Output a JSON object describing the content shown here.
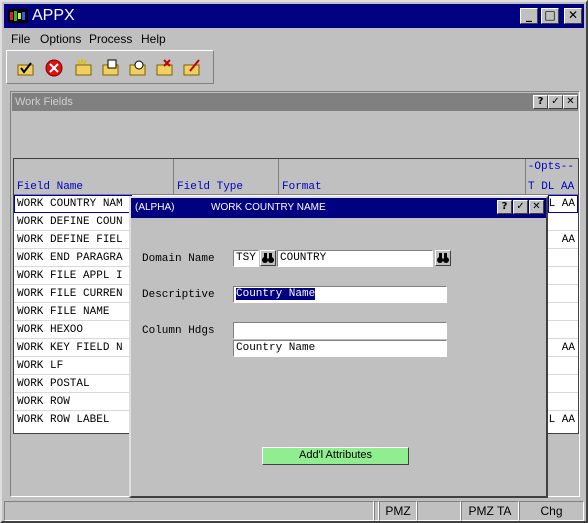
{
  "app": {
    "title": "APPX"
  },
  "window_controls": {
    "minimize": "_",
    "maximize": "□",
    "close": "✕"
  },
  "menu": [
    "File",
    "Options",
    "Process",
    "Help"
  ],
  "toolbar": {
    "icons": [
      "check-folder-icon",
      "stop-icon",
      "new-folder-icon",
      "open-folder-icon",
      "search-folder-icon",
      "delete-folder-icon",
      "edit-folder-icon"
    ]
  },
  "work_fields": {
    "title": "Work Fields",
    "controls": {
      "help": "?",
      "ok": "✓",
      "close": "✕"
    },
    "columns": {
      "field_name": "Field Name",
      "field_type": "Field Type",
      "format": "Format",
      "opts": "-Opts--",
      "opts_sub": "T DL AA"
    },
    "rows": [
      {
        "name": "WORK COUNTRY NAM",
        "opts": "L AA"
      },
      {
        "name": "WORK DEFINE COUN",
        "opts": ""
      },
      {
        "name": "WORK DEFINE FIEL",
        "opts": "AA"
      },
      {
        "name": "WORK END PARAGRA",
        "opts": ""
      },
      {
        "name": "WORK FILE APPL I",
        "opts": ""
      },
      {
        "name": "WORK FILE CURREN",
        "opts": ""
      },
      {
        "name": "WORK FILE NAME",
        "opts": ""
      },
      {
        "name": "WORK HEXOO",
        "opts": ""
      },
      {
        "name": "WORK KEY FIELD N",
        "opts": "AA"
      },
      {
        "name": "WORK LF",
        "opts": ""
      },
      {
        "name": "WORK POSTAL",
        "opts": ""
      },
      {
        "name": "WORK ROW",
        "opts": ""
      },
      {
        "name": "WORK ROW LABEL",
        "opts": "L AA"
      }
    ]
  },
  "dialog": {
    "type": "(ALPHA)",
    "name": "WORK COUNTRY NAME",
    "controls": {
      "help": "?",
      "ok": "✓",
      "close": "✕"
    },
    "domain_label": "Domain Name",
    "domain_app": "TSY",
    "domain_value": "COUNTRY",
    "descriptive_label": "Descriptive",
    "descriptive_value": "Country Name",
    "column_hdgs_label": "Column Hdgs",
    "column_hdg_1": "",
    "column_hdg_2": "Country Name",
    "attributes_button": "Add'l Attributes",
    "attributes_button_color": "#90ee90"
  },
  "status": [
    "",
    "",
    "PMZ",
    "",
    "PMZ TA",
    "Chg"
  ]
}
